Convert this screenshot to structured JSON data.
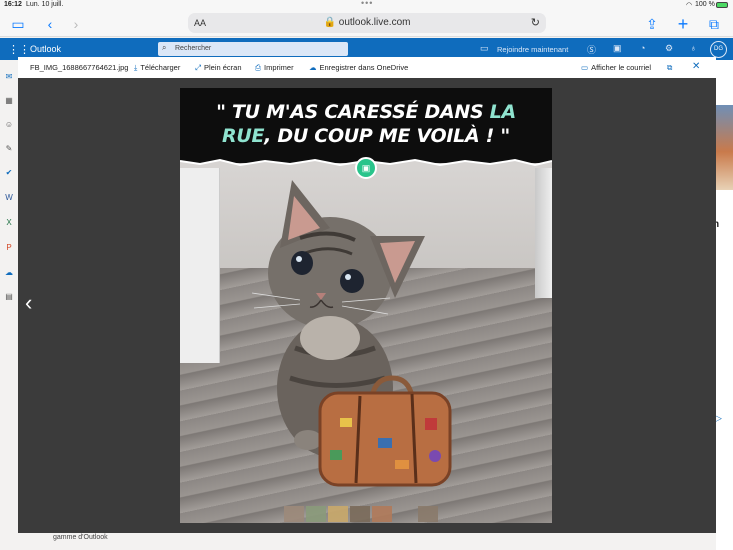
{
  "status_bar": {
    "time": "16:12",
    "date": "Lun. 10 juill.",
    "battery": "100 %"
  },
  "browser": {
    "aa_label": "AA",
    "url": "outlook.live.com"
  },
  "outlook": {
    "brand": "Outlook",
    "search_placeholder": "Rechercher",
    "join_now": "Rejoindre maintenant",
    "avatar_initials": "DG"
  },
  "viewer": {
    "filename": "FB_IMG_1688667764621.jpg",
    "download": "Télécharger",
    "fullscreen": "Plein écran",
    "print": "Imprimer",
    "save_onedrive": "Enregistrer dans OneDrive",
    "show_email": "Afficher le courriel"
  },
  "image": {
    "caption_part1": "\" TU M'AS CARESSÉ DANS ",
    "caption_hl1": "LA",
    "caption_hl2": "RUE",
    "caption_part2": ", DU COUP ME VOILÀ ! \""
  },
  "background": {
    "footer_text": "gamme d'Outlook",
    "partial_letter": "n"
  },
  "colors": {
    "outlook_blue": "#0f6cbd",
    "caption_highlight": "#8fe3cf",
    "badge_green": "#29c48b"
  }
}
